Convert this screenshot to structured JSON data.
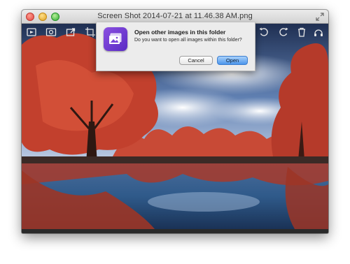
{
  "window": {
    "title": "Screen Shot 2014-07-21 at 11.46.38 AM.png"
  },
  "toolbar": {
    "icons": [
      "slideshow-icon",
      "view-icon",
      "export-icon",
      "crop-icon",
      "rotate-left-icon",
      "rotate-right-icon",
      "trash-icon",
      "share-icon"
    ]
  },
  "dialog": {
    "title": "Open other images in this folder",
    "message": "Do you want to open all images within this folder?",
    "cancel_label": "Cancel",
    "open_label": "Open"
  },
  "colors": {
    "default_button": "#4c96ec",
    "app_icon": "#7a43d9"
  }
}
